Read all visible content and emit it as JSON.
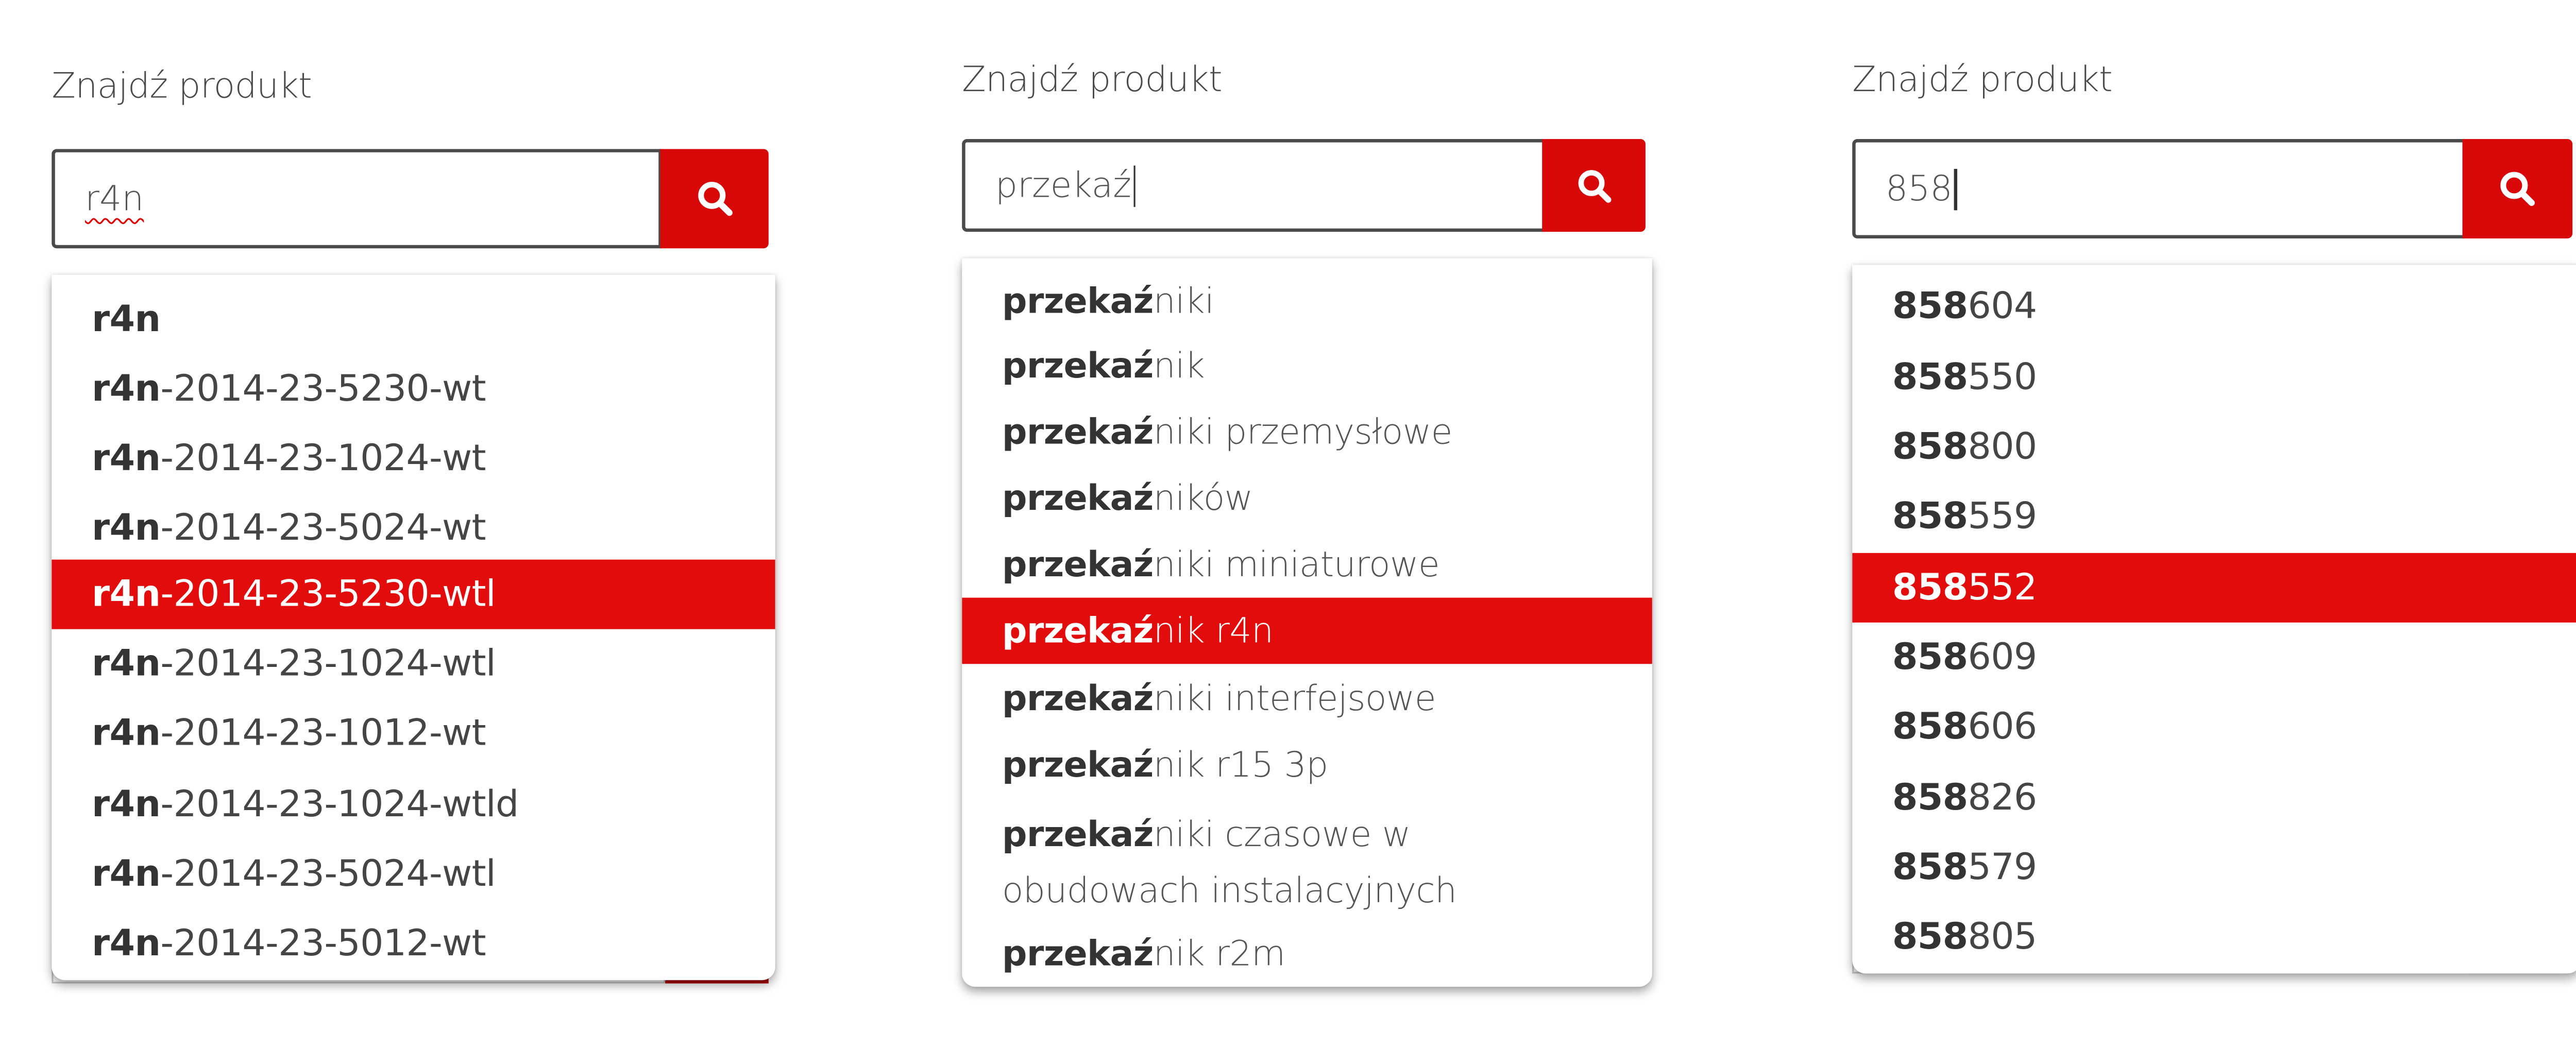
{
  "accent_color": "#d90808",
  "selected_color": "#e20c0c",
  "search_icon": "search-icon",
  "widgets": [
    {
      "label": "Znajdź produkt",
      "input_value": "r4n",
      "results": [
        {
          "bold": "r4n",
          "rest": ""
        },
        {
          "bold": "r4n",
          "rest": "-2014-23-5230-wt"
        },
        {
          "bold": "r4n",
          "rest": "-2014-23-1024-wt"
        },
        {
          "bold": "r4n",
          "rest": "-2014-23-5024-wt"
        },
        {
          "bold": "r4n",
          "rest": "-2014-23-5230-wtl"
        },
        {
          "bold": "r4n",
          "rest": "-2014-23-1024-wtl"
        },
        {
          "bold": "r4n",
          "rest": "-2014-23-1012-wt"
        },
        {
          "bold": "r4n",
          "rest": "-2014-23-1024-wtld"
        },
        {
          "bold": "r4n",
          "rest": "-2014-23-5024-wtl"
        },
        {
          "bold": "r4n",
          "rest": "-2014-23-5012-wt"
        }
      ]
    },
    {
      "label": "Znajdź produkt",
      "input_value": "przekaź",
      "results": [
        {
          "bold": "przekaź",
          "rest": "niki"
        },
        {
          "bold": "przekaź",
          "rest": "nik"
        },
        {
          "bold": "przekaź",
          "rest": "niki przemysłowe"
        },
        {
          "bold": "przekaź",
          "rest": "ników"
        },
        {
          "bold": "przekaź",
          "rest": "niki miniaturowe"
        },
        {
          "bold": "przekaź",
          "rest": "nik r4n"
        },
        {
          "bold": "przekaź",
          "rest": "niki interfejsowe"
        },
        {
          "bold": "przekaź",
          "rest": "nik r15 3p"
        },
        {
          "bold": "przekaź",
          "rest": "niki czasowe w obudowach instalacyjnych"
        },
        {
          "bold": "przekaź",
          "rest": "nik r2m"
        }
      ]
    },
    {
      "label": "Znajdź produkt",
      "input_value": "858",
      "results": [
        {
          "bold": "858",
          "rest": "604"
        },
        {
          "bold": "858",
          "rest": "550"
        },
        {
          "bold": "858",
          "rest": "800"
        },
        {
          "bold": "858",
          "rest": "559"
        },
        {
          "bold": "858",
          "rest": "552"
        },
        {
          "bold": "858",
          "rest": "609"
        },
        {
          "bold": "858",
          "rest": "606"
        },
        {
          "bold": "858",
          "rest": "826"
        },
        {
          "bold": "858",
          "rest": "579"
        },
        {
          "bold": "858",
          "rest": "805"
        }
      ]
    }
  ]
}
